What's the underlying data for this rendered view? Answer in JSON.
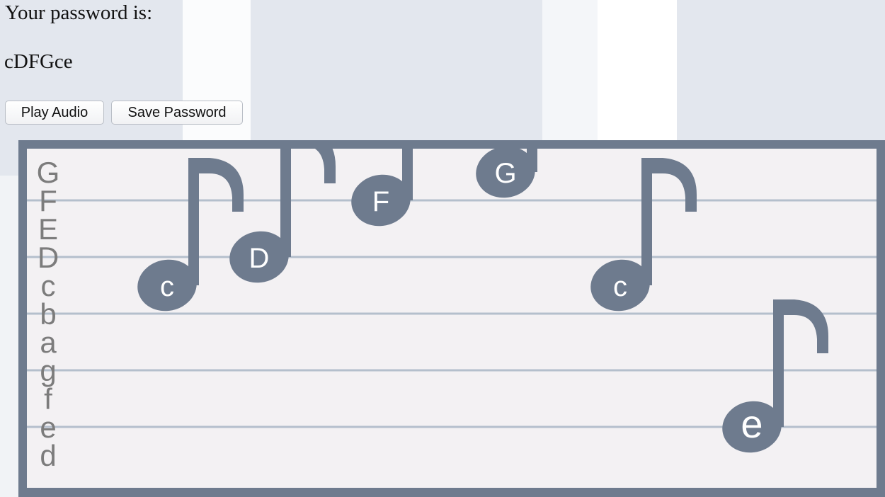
{
  "intro_text": "Your password is:",
  "password": "cDFGce",
  "buttons": {
    "play_label": "Play Audio",
    "save_label": "Save Password"
  },
  "staff": {
    "pitch_labels": [
      "G",
      "F",
      "E",
      "D",
      "c",
      "b",
      "a",
      "g",
      "f",
      "e",
      "d"
    ],
    "notes": [
      {
        "pitch": "c",
        "label": "c"
      },
      {
        "pitch": "D",
        "label": "D"
      },
      {
        "pitch": "F",
        "label": "F"
      },
      {
        "pitch": "G",
        "label": "G"
      },
      {
        "pitch": "c",
        "label": "c"
      },
      {
        "pitch": "e",
        "label": "e"
      }
    ],
    "colors": {
      "note": "#6e7b8e",
      "line": "#b4bfcc",
      "label": "#7c7c7c",
      "background": "#f3f1f3",
      "frame": "#6e7b8e"
    }
  }
}
